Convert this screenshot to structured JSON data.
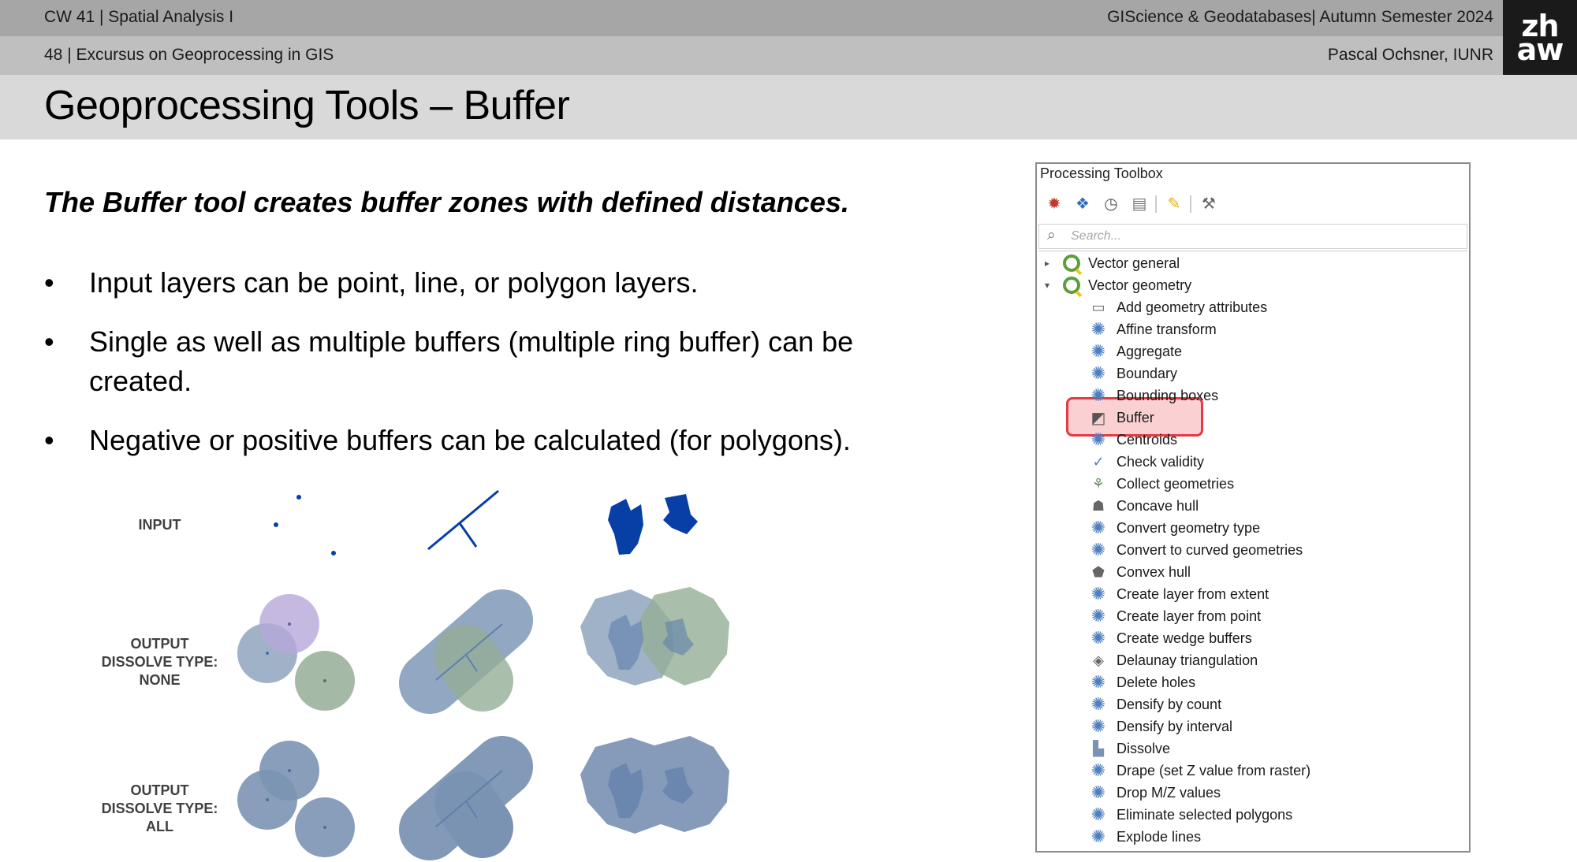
{
  "header": {
    "course": "CW 41 | Spatial Analysis I",
    "module": "GIScience & Geodatabases| Autumn Semester 2024",
    "slide": "48 | Excursus on Geoprocessing in GIS",
    "author": "Pascal Ochsner, IUNR",
    "logo_line1": "zh",
    "logo_line2": "aw"
  },
  "title": "Geoprocessing Tools – Buffer",
  "lead": "The Buffer tool creates buffer zones with defined distances.",
  "bullets": [
    "Input layers can be point, line, or polygon layers.",
    "Single as well as multiple buffers (multiple ring buffer) can be created.",
    "Negative or positive buffers can be calculated (for polygons)."
  ],
  "bullet_glyph": "•",
  "illustration": {
    "row1_label": "INPUT",
    "row2_label_l1": "OUTPUT",
    "row2_label_l2": "DISSOLVE TYPE:",
    "row2_label_l3": "NONE",
    "row3_label_l1": "OUTPUT",
    "row3_label_l2": "DISSOLVE TYPE:",
    "row3_label_l3": "ALL",
    "colors": {
      "input": "#073fa6",
      "buffer_blue": "#7f98b6",
      "buffer_purple": "#b7a7d9",
      "buffer_green": "#94ae96",
      "dissolved": "#7b93b3"
    }
  },
  "toolbox": {
    "title": "Processing Toolbox",
    "search_placeholder": "Search...",
    "toolbar_icons": [
      "run-model-icon",
      "python-icon",
      "history-icon",
      "results-icon",
      "edit-in-place-icon",
      "options-icon"
    ],
    "groups": [
      {
        "label": "Vector general",
        "expanded": false
      },
      {
        "label": "Vector geometry",
        "expanded": true
      }
    ],
    "items": [
      "Add geometry attributes",
      "Affine transform",
      "Aggregate",
      "Boundary",
      "Bounding boxes",
      "Buffer",
      "Centroids",
      "Check validity",
      "Collect geometries",
      "Concave hull",
      "Convert geometry type",
      "Convert to curved geometries",
      "Convex hull",
      "Create layer from extent",
      "Create layer from point",
      "Create wedge buffers",
      "Delaunay triangulation",
      "Delete holes",
      "Densify by count",
      "Densify by interval",
      "Dissolve",
      "Drape (set Z value from raster)",
      "Drop M/Z values",
      "Eliminate selected polygons",
      "Explode lines"
    ],
    "selected_item": "Buffer",
    "highlight_color": "#e53945"
  }
}
